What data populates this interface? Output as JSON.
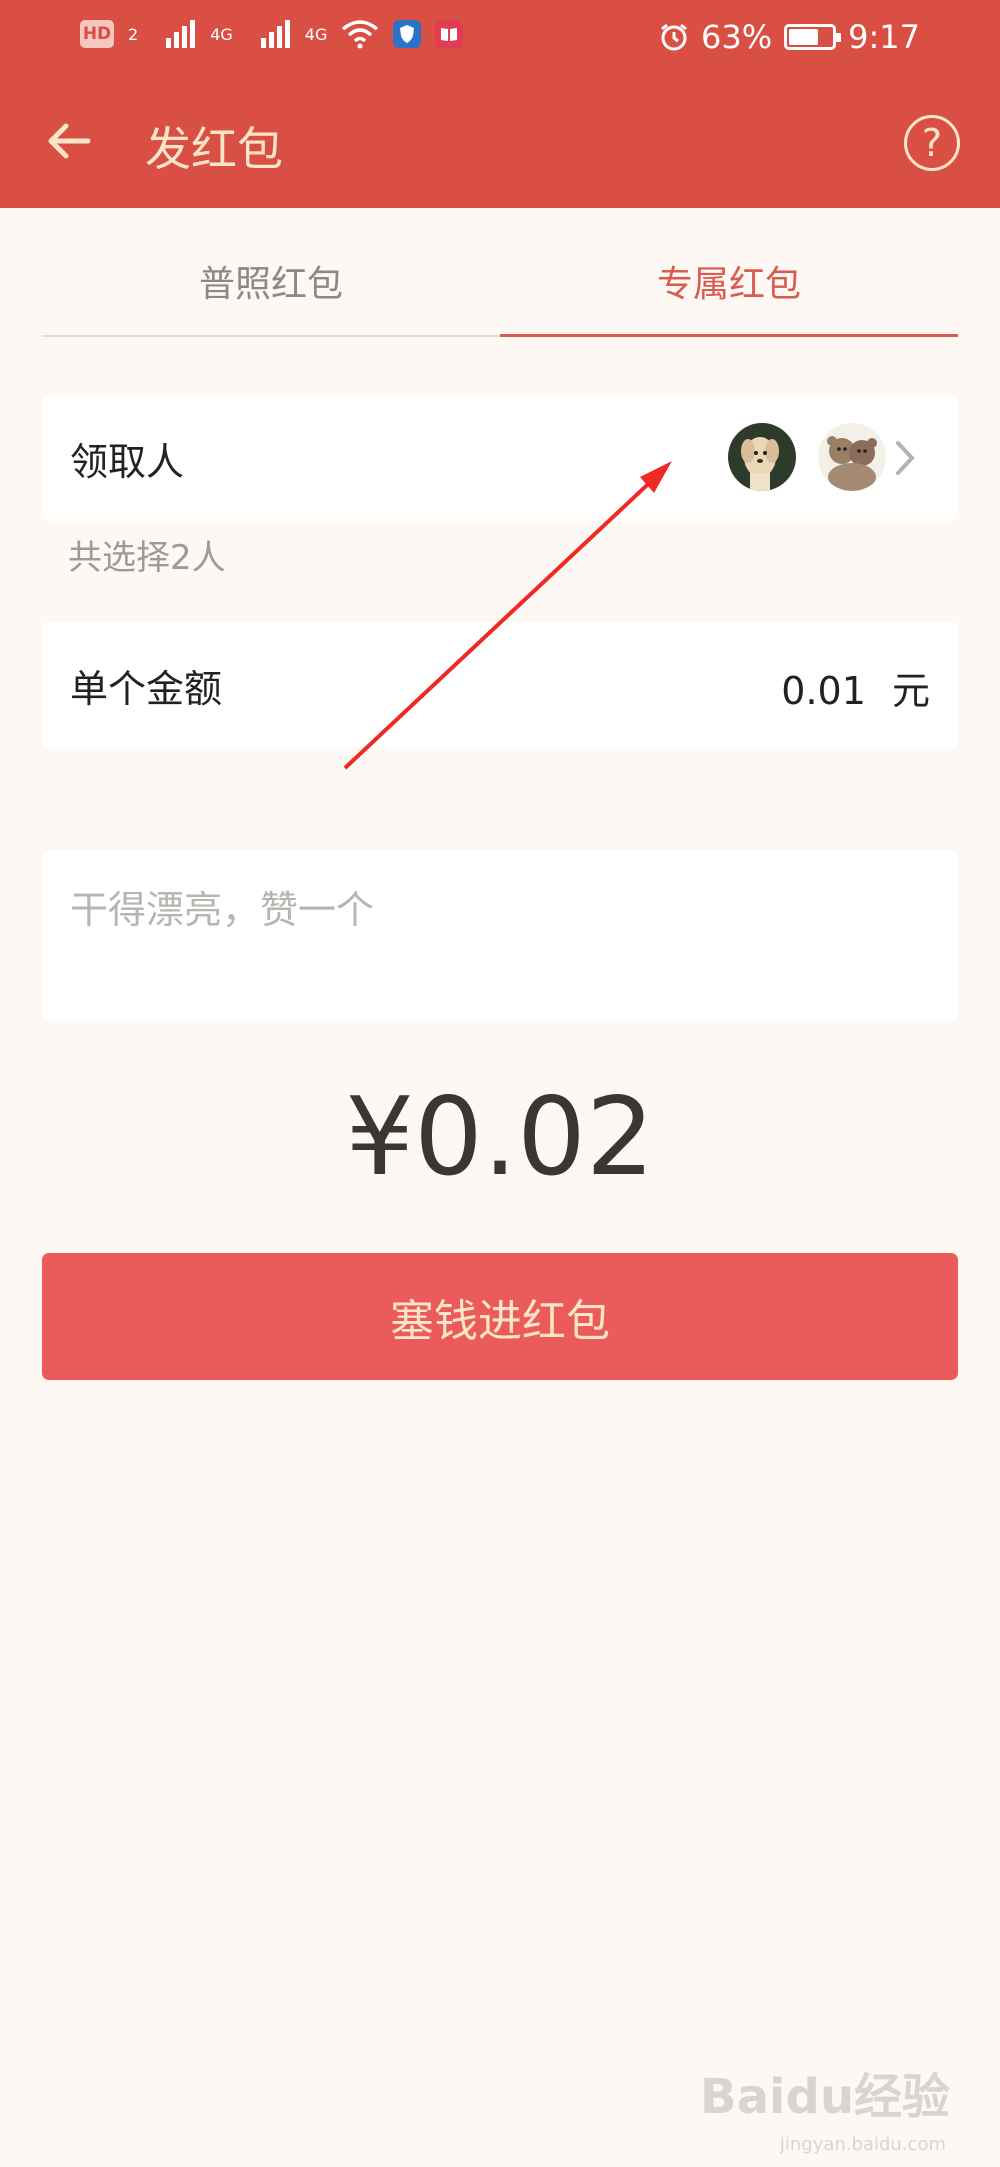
{
  "status_bar": {
    "hd": "HD",
    "sim": "2",
    "net1": "4G",
    "net2": "4G",
    "battery_percent": "63%",
    "battery_level": 0.63,
    "time": "9:17"
  },
  "header": {
    "title": "发红包",
    "help_label": "?"
  },
  "tabs": [
    {
      "label": "普照红包",
      "active": false
    },
    {
      "label": "专属红包",
      "active": true
    }
  ],
  "recipient": {
    "label": "领取人",
    "avatars": [
      "puppy-avatar",
      "teddy-bear-avatar"
    ],
    "selected_hint": "共选择2人"
  },
  "amount": {
    "label": "单个金额",
    "value": "0.01",
    "unit": "元"
  },
  "message": {
    "placeholder": "干得漂亮，赞一个"
  },
  "total": "¥0.02",
  "submit_label": "塞钱进红包",
  "watermark": {
    "brand": "Baidu经验",
    "url": "jingyan.baidu.com"
  },
  "colors": {
    "header_bg": "#d94f44",
    "accent": "#d95c4e",
    "button_bg": "#ec5b5c",
    "button_text": "#fbe5c8"
  }
}
